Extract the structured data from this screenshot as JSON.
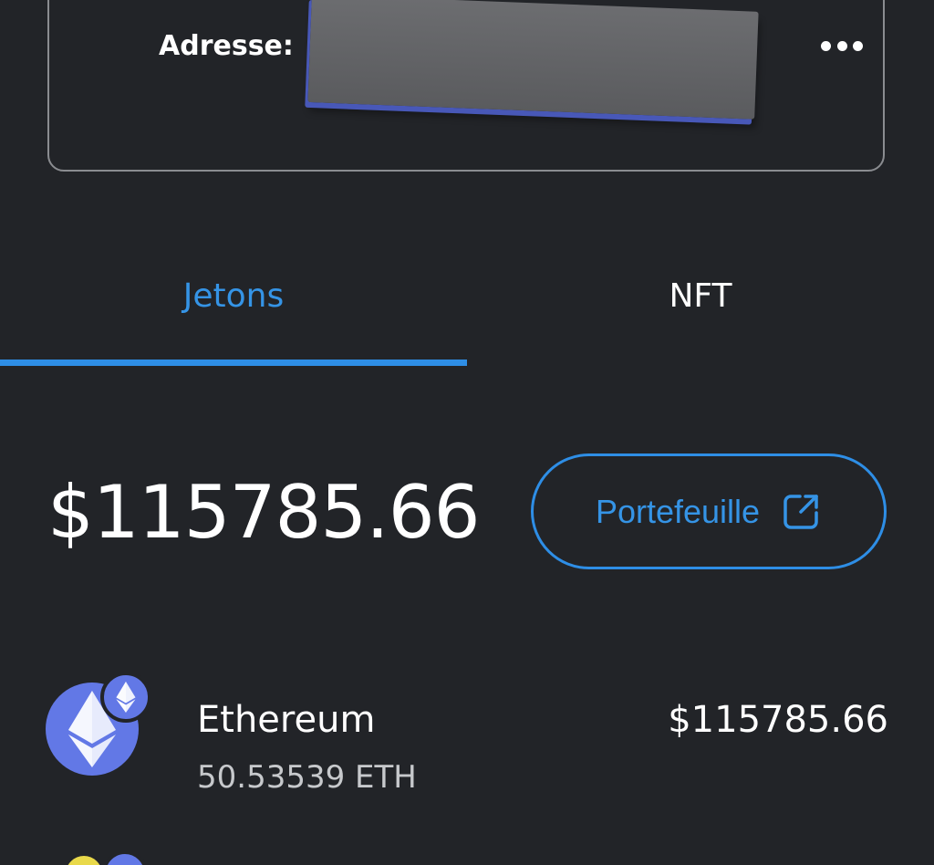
{
  "address_card": {
    "label": "Adresse:",
    "more_icon": "more-horizontal-icon"
  },
  "tabs": [
    {
      "label": "Jetons",
      "active": true
    },
    {
      "label": "NFT",
      "active": false
    }
  ],
  "balance": {
    "total": "$115785.66",
    "portfolio_button_label": "Portefeuille",
    "portfolio_icon": "external-link-icon"
  },
  "tokens": [
    {
      "name": "Ethereum",
      "amount": "50.53539 ETH",
      "value": "$115785.66",
      "icon": "ethereum-icon",
      "network_icon": "ethereum-network-badge-icon"
    }
  ],
  "colors": {
    "background": "#222428",
    "accent": "#2e8ee6",
    "ethereum": "#6278e6",
    "card_border": "#8a8c90"
  }
}
